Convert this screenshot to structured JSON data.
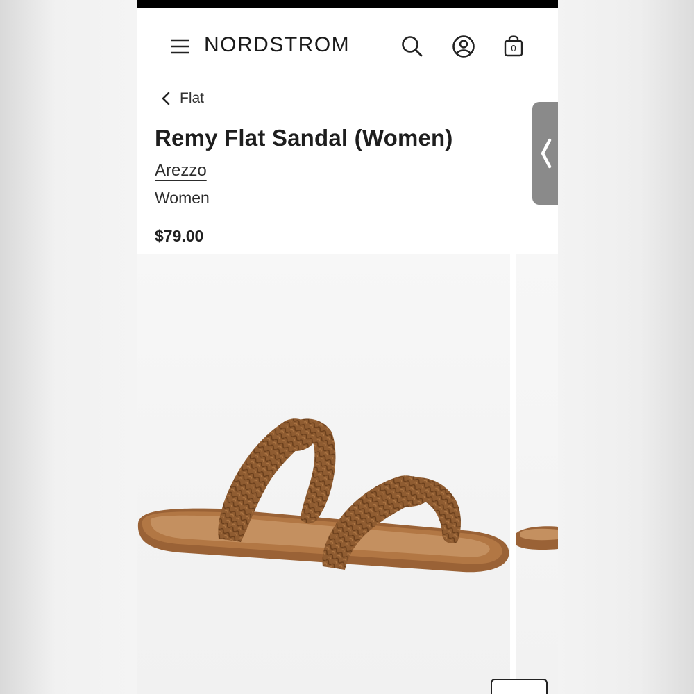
{
  "header": {
    "logo": "NORDSTROM",
    "bag_count": "0"
  },
  "breadcrumb": {
    "label": "Flat"
  },
  "product": {
    "title": "Remy Flat Sandal (Women)",
    "brand": "Arezzo",
    "category": "Women",
    "price": "$79.00"
  },
  "colors": {
    "leather": "#8b5a30",
    "sole": "#a86b3e",
    "side_tab": "#8a8a8a"
  }
}
